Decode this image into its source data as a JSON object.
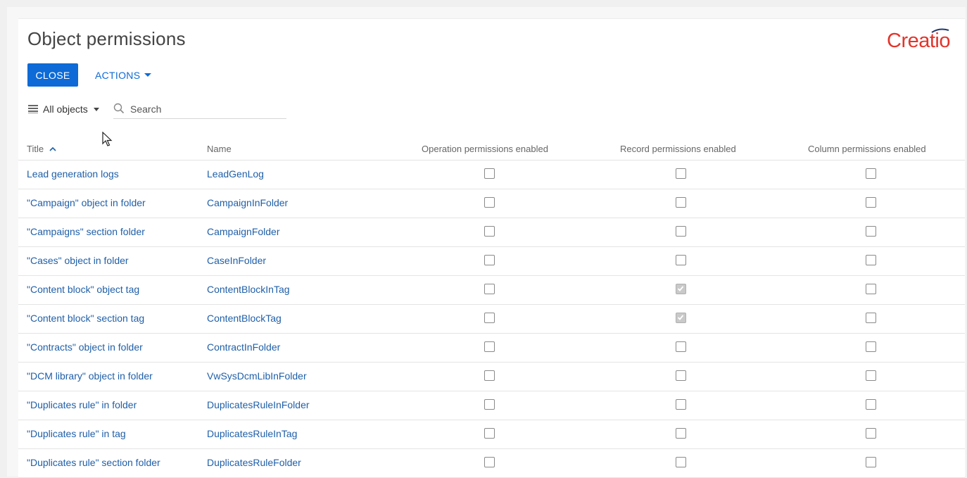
{
  "page": {
    "title": "Object permissions",
    "logo_text": "Creatio"
  },
  "toolbar": {
    "close_label": "CLOSE",
    "actions_label": "ACTIONS"
  },
  "filter": {
    "selected": "All objects",
    "search_placeholder": "Search"
  },
  "columns": {
    "title": "Title",
    "name": "Name",
    "operation": "Operation permissions enabled",
    "record": "Record permissions enabled",
    "column": "Column permissions enabled"
  },
  "rows": [
    {
      "title": "Lead generation logs",
      "name": "LeadGenLog",
      "operation": false,
      "record": false,
      "column": false
    },
    {
      "title": "\"Campaign\" object in folder",
      "name": "CampaignInFolder",
      "operation": false,
      "record": false,
      "column": false
    },
    {
      "title": "\"Campaigns\" section folder",
      "name": "CampaignFolder",
      "operation": false,
      "record": false,
      "column": false
    },
    {
      "title": "\"Cases\" object in folder",
      "name": "CaseInFolder",
      "operation": false,
      "record": false,
      "column": false
    },
    {
      "title": "\"Content block\" object tag",
      "name": "ContentBlockInTag",
      "operation": false,
      "record": true,
      "column": false
    },
    {
      "title": "\"Content block\" section tag",
      "name": "ContentBlockTag",
      "operation": false,
      "record": true,
      "column": false
    },
    {
      "title": "\"Contracts\" object in folder",
      "name": "ContractInFolder",
      "operation": false,
      "record": false,
      "column": false
    },
    {
      "title": "\"DCM library\" object in folder",
      "name": "VwSysDcmLibInFolder",
      "operation": false,
      "record": false,
      "column": false
    },
    {
      "title": "\"Duplicates rule\" in folder",
      "name": "DuplicatesRuleInFolder",
      "operation": false,
      "record": false,
      "column": false
    },
    {
      "title": "\"Duplicates rule\" in tag",
      "name": "DuplicatesRuleInTag",
      "operation": false,
      "record": false,
      "column": false
    },
    {
      "title": "\"Duplicates rule\" section folder",
      "name": "DuplicatesRuleFolder",
      "operation": false,
      "record": false,
      "column": false
    }
  ],
  "colors": {
    "accent": "#0d6ad6",
    "link": "#1f5fa8",
    "logo": "#e2352b"
  },
  "icons": {
    "list": "list-icon",
    "search": "search-icon",
    "sort": "chevron-up-icon",
    "cursor": "mouse-cursor-icon"
  }
}
